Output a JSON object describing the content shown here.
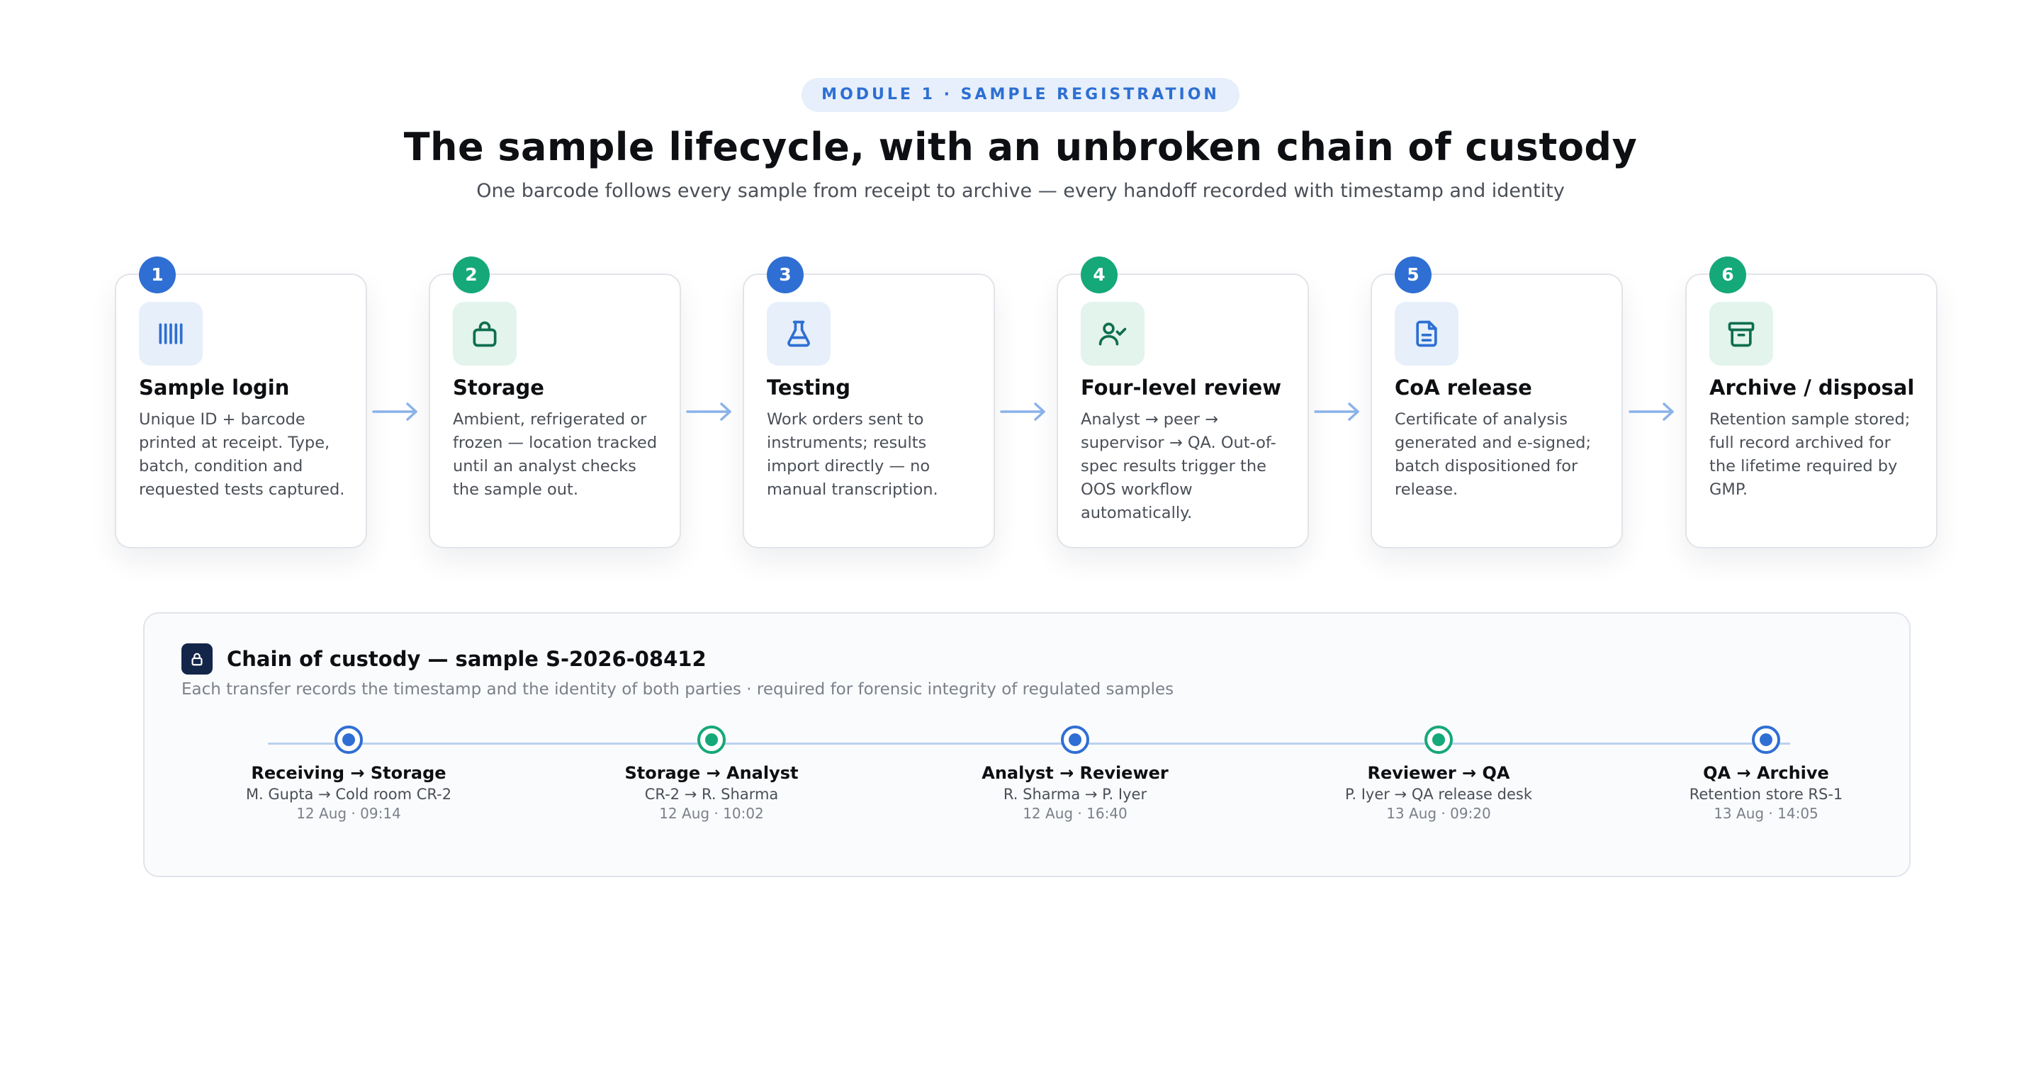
{
  "header": {
    "eyebrow": "MODULE 1 · SAMPLE REGISTRATION",
    "title": "The sample lifecycle, with an unbroken chain of custody",
    "subtitle": "One barcode follows every sample from receipt to archive — every handoff recorded with timestamp and identity"
  },
  "colors": {
    "blue": "#2f6fd3",
    "green": "#15a878",
    "navy": "#13264a",
    "arrow": "#8ab2ea"
  },
  "steps": [
    {
      "number": "1",
      "icon": "barcode-icon",
      "title": "Sample login",
      "desc": "Unique ID + barcode printed at receipt. Type, batch, condition and requested tests captured."
    },
    {
      "number": "2",
      "icon": "bag-icon",
      "title": "Storage",
      "desc": "Ambient, refrigerated or frozen — location tracked until an analyst checks the sample out."
    },
    {
      "number": "3",
      "icon": "flask-icon",
      "title": "Testing",
      "desc": "Work orders sent to instruments; results import directly — no manual transcription."
    },
    {
      "number": "4",
      "icon": "user-check-icon",
      "title": "Four-level review",
      "desc": "Analyst → peer → supervisor → QA. Out-of-spec results trigger the OOS workflow automatically."
    },
    {
      "number": "5",
      "icon": "document-icon",
      "title": "CoA release",
      "desc": "Certificate of analysis generated and e-signed; batch dispositioned for release."
    },
    {
      "number": "6",
      "icon": "archive-icon",
      "title": "Archive / disposal",
      "desc": "Retention sample stored; full record archived for the lifetime required by GMP."
    }
  ],
  "custody": {
    "icon": "lock-icon",
    "title": "Chain of custody — sample S-2026-08412",
    "desc": "Each transfer records the timestamp and the identity of both parties · required for forensic integrity of regulated samples",
    "transfers": [
      {
        "label": "Receiving → Storage",
        "who": "M. Gupta → Cold room CR-2",
        "when": "12 Aug · 09:14"
      },
      {
        "label": "Storage → Analyst",
        "who": "CR-2 → R. Sharma",
        "when": "12 Aug · 10:02"
      },
      {
        "label": "Analyst → Reviewer",
        "who": "R. Sharma → P. Iyer",
        "when": "12 Aug · 16:40"
      },
      {
        "label": "Reviewer → QA",
        "who": "P. Iyer → QA release desk",
        "when": "13 Aug · 09:20"
      },
      {
        "label": "QA → Archive",
        "who": "Retention store RS-1",
        "when": "13 Aug · 14:05"
      }
    ]
  }
}
